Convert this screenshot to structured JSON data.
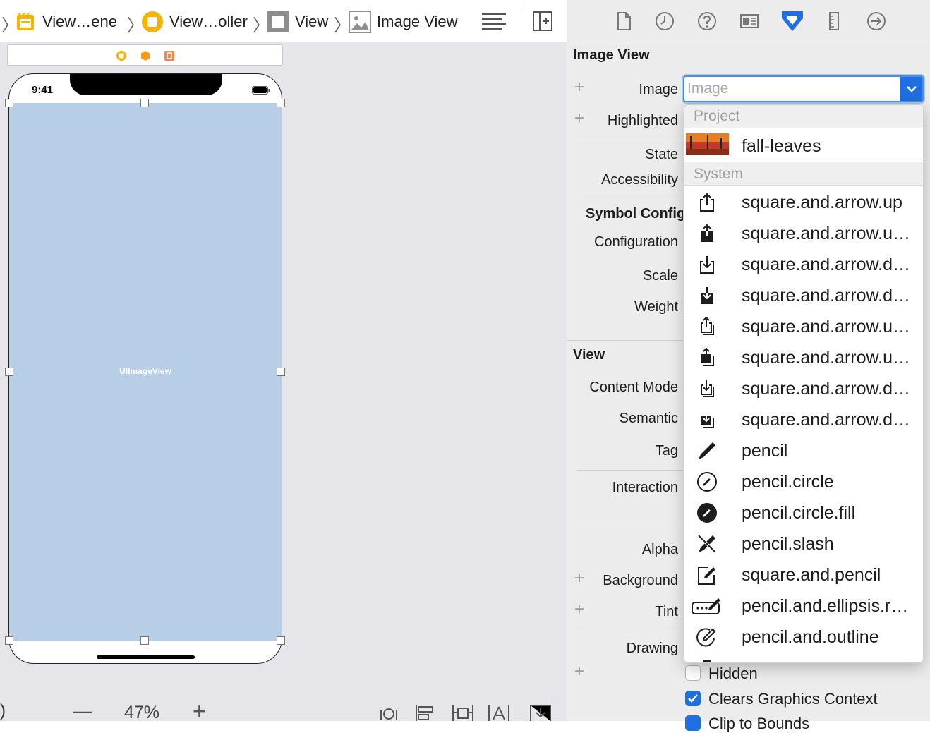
{
  "jumpbar": {
    "crumbs": [
      "View…ene",
      "View…oller",
      "View",
      "Image View"
    ]
  },
  "phone": {
    "time": "9:41",
    "image_view_label": "UIImageView"
  },
  "canvas_bottom": {
    "zoom": "47%",
    "minus": "—",
    "plus": "+",
    "paren": ")"
  },
  "inspector": {
    "section_image_view": "Image View",
    "labels": {
      "image": "Image",
      "highlighted": "Highlighted",
      "state": "State",
      "accessibility": "Accessibility",
      "symbol_config": "Symbol Configuration",
      "configuration": "Configuration",
      "scale": "Scale",
      "weight": "Weight",
      "content_mode": "Content Mode",
      "semantic": "Semantic",
      "tag": "Tag",
      "interaction": "Interaction",
      "alpha": "Alpha",
      "background": "Background",
      "tint": "Tint",
      "drawing": "Drawing"
    },
    "section_view": "View",
    "image_placeholder": "Image",
    "checkboxes": [
      {
        "label": "Hidden",
        "checked": false
      },
      {
        "label": "Clears Graphics Context",
        "checked": true
      },
      {
        "label": "Clip to Bounds",
        "checked": true
      }
    ]
  },
  "popup": {
    "project_header": "Project",
    "project_items": [
      {
        "label": "fall-leaves"
      }
    ],
    "system_header": "System",
    "system_items": [
      {
        "label": "square.and.arrow.up",
        "icon": "share-icon"
      },
      {
        "label": "square.and.arrow.u…",
        "icon": "share-fill-icon"
      },
      {
        "label": "square.and.arrow.d…",
        "icon": "download-icon"
      },
      {
        "label": "square.and.arrow.d…",
        "icon": "download-fill-icon"
      },
      {
        "label": "square.and.arrow.u…",
        "icon": "share-stack-icon"
      },
      {
        "label": "square.and.arrow.u…",
        "icon": "share-stack-fill-icon"
      },
      {
        "label": "square.and.arrow.d…",
        "icon": "download-stack-icon"
      },
      {
        "label": "square.and.arrow.d…",
        "icon": "download-stack-fill-icon"
      },
      {
        "label": "pencil",
        "icon": "pencil-icon"
      },
      {
        "label": "pencil.circle",
        "icon": "pencil-circle-icon"
      },
      {
        "label": "pencil.circle.fill",
        "icon": "pencil-circle-fill-icon"
      },
      {
        "label": "pencil.slash",
        "icon": "pencil-slash-icon"
      },
      {
        "label": "square.and.pencil",
        "icon": "square-pencil-icon"
      },
      {
        "label": "pencil.and.ellipsis.r…",
        "icon": "pencil-ellipsis-icon"
      },
      {
        "label": "pencil.and.outline",
        "icon": "pencil-outline-icon"
      }
    ]
  },
  "colors": {
    "accent": "#1f6fe0",
    "image_view_fill": "#b8cde6"
  }
}
